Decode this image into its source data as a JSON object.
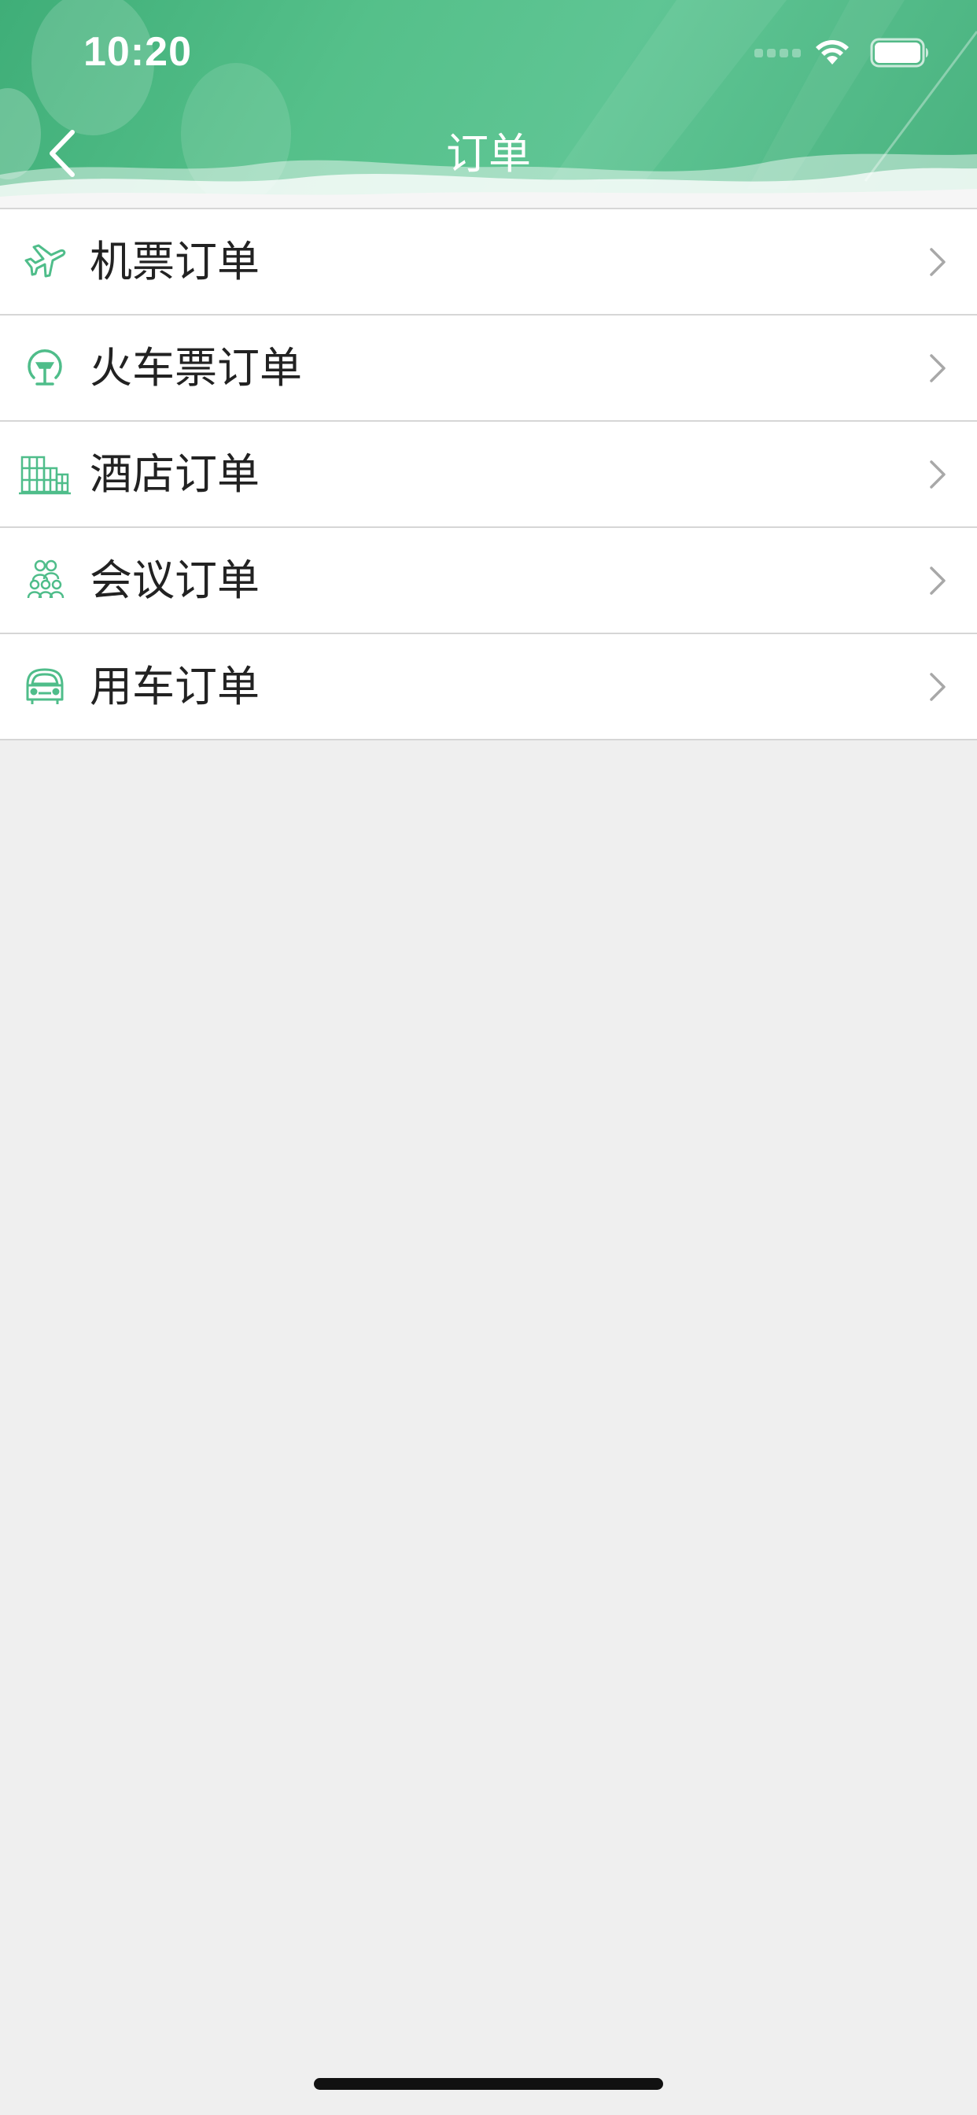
{
  "status_bar": {
    "time": "10:20",
    "wifi_icon": "wifi-icon",
    "battery_icon": "battery-icon"
  },
  "nav": {
    "title": "订单",
    "back_icon": "chevron-left-icon"
  },
  "orders": [
    {
      "label": "机票订单",
      "icon": "airplane-icon"
    },
    {
      "label": "火车票订单",
      "icon": "train-icon"
    },
    {
      "label": "酒店订单",
      "icon": "hotel-icon"
    },
    {
      "label": "会议订单",
      "icon": "meeting-icon"
    },
    {
      "label": "用车订单",
      "icon": "car-icon"
    }
  ],
  "colors": {
    "accent": "#4fbd8a",
    "header_green": "#55c08a",
    "background": "#efefef",
    "chevron": "#a8a8a8"
  }
}
